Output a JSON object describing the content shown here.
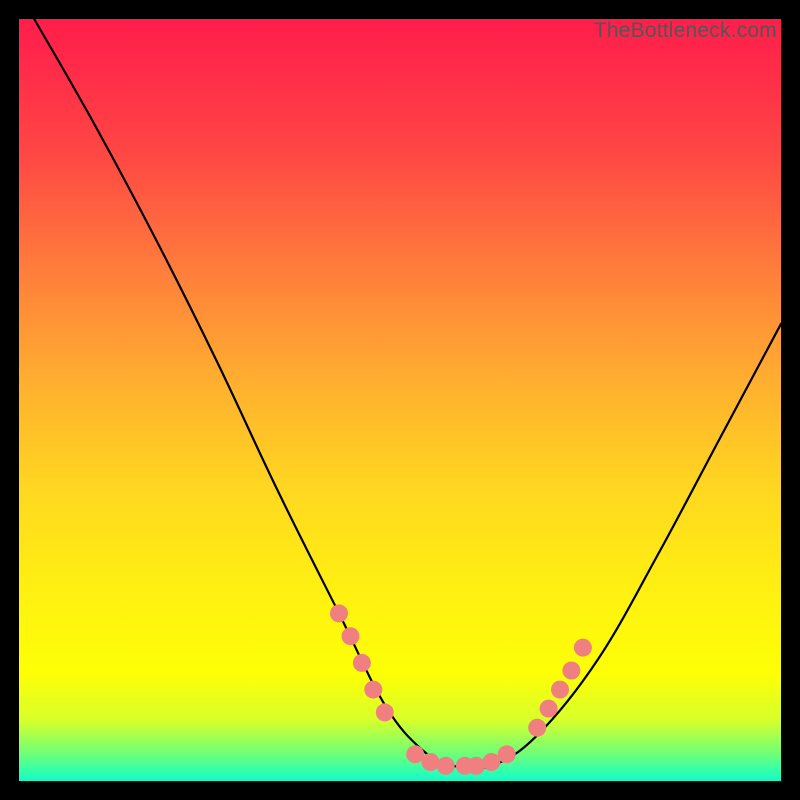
{
  "watermark": "TheBottleneck.com",
  "chart_data": {
    "type": "line",
    "title": "",
    "xlabel": "",
    "ylabel": "",
    "xlim": [
      0,
      100
    ],
    "ylim": [
      0,
      100
    ],
    "series": [
      {
        "name": "curve",
        "x": [
          2,
          10,
          18,
          26,
          34,
          42,
          48,
          53,
          57,
          62,
          68,
          76,
          84,
          92,
          100
        ],
        "y": [
          100,
          86,
          71,
          55,
          38,
          22,
          10,
          4,
          2,
          2,
          6,
          16,
          30,
          45,
          60
        ]
      }
    ],
    "markers": [
      {
        "x": 42.0,
        "y": 22.0
      },
      {
        "x": 43.5,
        "y": 19.0
      },
      {
        "x": 45.0,
        "y": 15.5
      },
      {
        "x": 46.5,
        "y": 12.0
      },
      {
        "x": 48.0,
        "y": 9.0
      },
      {
        "x": 52.0,
        "y": 3.5
      },
      {
        "x": 54.0,
        "y": 2.5
      },
      {
        "x": 56.0,
        "y": 2.0
      },
      {
        "x": 58.5,
        "y": 2.0
      },
      {
        "x": 60.0,
        "y": 2.0
      },
      {
        "x": 62.0,
        "y": 2.5
      },
      {
        "x": 64.0,
        "y": 3.5
      },
      {
        "x": 68.0,
        "y": 7.0
      },
      {
        "x": 69.5,
        "y": 9.5
      },
      {
        "x": 71.0,
        "y": 12.0
      },
      {
        "x": 72.5,
        "y": 14.5
      },
      {
        "x": 74.0,
        "y": 17.5
      }
    ],
    "marker_color": "#f08080",
    "curve_color": "#000000"
  }
}
